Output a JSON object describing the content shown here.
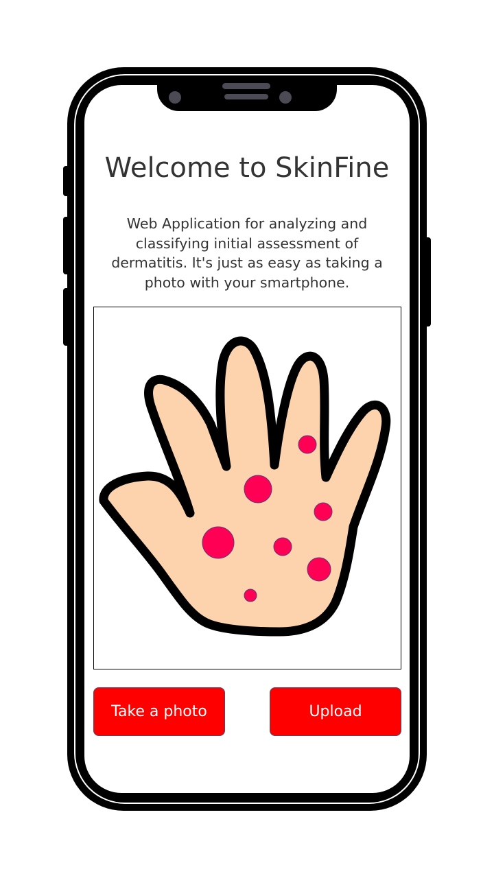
{
  "header": {
    "title": "Welcome to SkinFine"
  },
  "intro": {
    "description": "Web Application for analyzing and classifying initial assessment of dermatitis. It's just as easy as taking a photo with your smartphone."
  },
  "illustration": {
    "icon": "hand-with-rash-illustration",
    "skin_color": "#fcd3ac",
    "spot_color": "#ff0055",
    "outline_color": "#000000"
  },
  "actions": {
    "take_photo_label": "Take a photo",
    "upload_label": "Upload",
    "button_color": "#ff0000"
  }
}
